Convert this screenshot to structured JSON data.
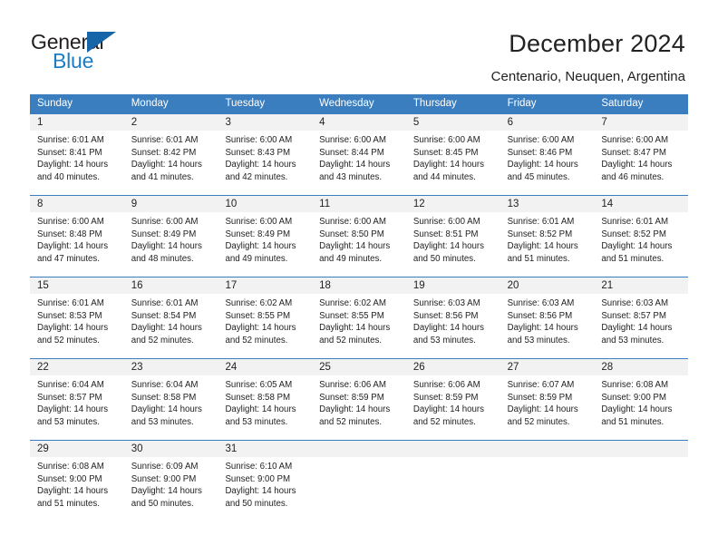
{
  "brand": {
    "name_part1": "General",
    "name_part2": "Blue",
    "triangle_icon": "triangle-icon",
    "accent_color": "#1d7dc4",
    "header_color": "#3a7ebf"
  },
  "header": {
    "title": "December 2024",
    "location": "Centenario, Neuquen, Argentina"
  },
  "calendar": {
    "weekdays": [
      "Sunday",
      "Monday",
      "Tuesday",
      "Wednesday",
      "Thursday",
      "Friday",
      "Saturday"
    ],
    "weeks": [
      [
        {
          "day": "1",
          "sunrise": "Sunrise: 6:01 AM",
          "sunset": "Sunset: 8:41 PM",
          "daylight_1": "Daylight: 14 hours",
          "daylight_2": "and 40 minutes."
        },
        {
          "day": "2",
          "sunrise": "Sunrise: 6:01 AM",
          "sunset": "Sunset: 8:42 PM",
          "daylight_1": "Daylight: 14 hours",
          "daylight_2": "and 41 minutes."
        },
        {
          "day": "3",
          "sunrise": "Sunrise: 6:00 AM",
          "sunset": "Sunset: 8:43 PM",
          "daylight_1": "Daylight: 14 hours",
          "daylight_2": "and 42 minutes."
        },
        {
          "day": "4",
          "sunrise": "Sunrise: 6:00 AM",
          "sunset": "Sunset: 8:44 PM",
          "daylight_1": "Daylight: 14 hours",
          "daylight_2": "and 43 minutes."
        },
        {
          "day": "5",
          "sunrise": "Sunrise: 6:00 AM",
          "sunset": "Sunset: 8:45 PM",
          "daylight_1": "Daylight: 14 hours",
          "daylight_2": "and 44 minutes."
        },
        {
          "day": "6",
          "sunrise": "Sunrise: 6:00 AM",
          "sunset": "Sunset: 8:46 PM",
          "daylight_1": "Daylight: 14 hours",
          "daylight_2": "and 45 minutes."
        },
        {
          "day": "7",
          "sunrise": "Sunrise: 6:00 AM",
          "sunset": "Sunset: 8:47 PM",
          "daylight_1": "Daylight: 14 hours",
          "daylight_2": "and 46 minutes."
        }
      ],
      [
        {
          "day": "8",
          "sunrise": "Sunrise: 6:00 AM",
          "sunset": "Sunset: 8:48 PM",
          "daylight_1": "Daylight: 14 hours",
          "daylight_2": "and 47 minutes."
        },
        {
          "day": "9",
          "sunrise": "Sunrise: 6:00 AM",
          "sunset": "Sunset: 8:49 PM",
          "daylight_1": "Daylight: 14 hours",
          "daylight_2": "and 48 minutes."
        },
        {
          "day": "10",
          "sunrise": "Sunrise: 6:00 AM",
          "sunset": "Sunset: 8:49 PM",
          "daylight_1": "Daylight: 14 hours",
          "daylight_2": "and 49 minutes."
        },
        {
          "day": "11",
          "sunrise": "Sunrise: 6:00 AM",
          "sunset": "Sunset: 8:50 PM",
          "daylight_1": "Daylight: 14 hours",
          "daylight_2": "and 49 minutes."
        },
        {
          "day": "12",
          "sunrise": "Sunrise: 6:00 AM",
          "sunset": "Sunset: 8:51 PM",
          "daylight_1": "Daylight: 14 hours",
          "daylight_2": "and 50 minutes."
        },
        {
          "day": "13",
          "sunrise": "Sunrise: 6:01 AM",
          "sunset": "Sunset: 8:52 PM",
          "daylight_1": "Daylight: 14 hours",
          "daylight_2": "and 51 minutes."
        },
        {
          "day": "14",
          "sunrise": "Sunrise: 6:01 AM",
          "sunset": "Sunset: 8:52 PM",
          "daylight_1": "Daylight: 14 hours",
          "daylight_2": "and 51 minutes."
        }
      ],
      [
        {
          "day": "15",
          "sunrise": "Sunrise: 6:01 AM",
          "sunset": "Sunset: 8:53 PM",
          "daylight_1": "Daylight: 14 hours",
          "daylight_2": "and 52 minutes."
        },
        {
          "day": "16",
          "sunrise": "Sunrise: 6:01 AM",
          "sunset": "Sunset: 8:54 PM",
          "daylight_1": "Daylight: 14 hours",
          "daylight_2": "and 52 minutes."
        },
        {
          "day": "17",
          "sunrise": "Sunrise: 6:02 AM",
          "sunset": "Sunset: 8:55 PM",
          "daylight_1": "Daylight: 14 hours",
          "daylight_2": "and 52 minutes."
        },
        {
          "day": "18",
          "sunrise": "Sunrise: 6:02 AM",
          "sunset": "Sunset: 8:55 PM",
          "daylight_1": "Daylight: 14 hours",
          "daylight_2": "and 52 minutes."
        },
        {
          "day": "19",
          "sunrise": "Sunrise: 6:03 AM",
          "sunset": "Sunset: 8:56 PM",
          "daylight_1": "Daylight: 14 hours",
          "daylight_2": "and 53 minutes."
        },
        {
          "day": "20",
          "sunrise": "Sunrise: 6:03 AM",
          "sunset": "Sunset: 8:56 PM",
          "daylight_1": "Daylight: 14 hours",
          "daylight_2": "and 53 minutes."
        },
        {
          "day": "21",
          "sunrise": "Sunrise: 6:03 AM",
          "sunset": "Sunset: 8:57 PM",
          "daylight_1": "Daylight: 14 hours",
          "daylight_2": "and 53 minutes."
        }
      ],
      [
        {
          "day": "22",
          "sunrise": "Sunrise: 6:04 AM",
          "sunset": "Sunset: 8:57 PM",
          "daylight_1": "Daylight: 14 hours",
          "daylight_2": "and 53 minutes."
        },
        {
          "day": "23",
          "sunrise": "Sunrise: 6:04 AM",
          "sunset": "Sunset: 8:58 PM",
          "daylight_1": "Daylight: 14 hours",
          "daylight_2": "and 53 minutes."
        },
        {
          "day": "24",
          "sunrise": "Sunrise: 6:05 AM",
          "sunset": "Sunset: 8:58 PM",
          "daylight_1": "Daylight: 14 hours",
          "daylight_2": "and 53 minutes."
        },
        {
          "day": "25",
          "sunrise": "Sunrise: 6:06 AM",
          "sunset": "Sunset: 8:59 PM",
          "daylight_1": "Daylight: 14 hours",
          "daylight_2": "and 52 minutes."
        },
        {
          "day": "26",
          "sunrise": "Sunrise: 6:06 AM",
          "sunset": "Sunset: 8:59 PM",
          "daylight_1": "Daylight: 14 hours",
          "daylight_2": "and 52 minutes."
        },
        {
          "day": "27",
          "sunrise": "Sunrise: 6:07 AM",
          "sunset": "Sunset: 8:59 PM",
          "daylight_1": "Daylight: 14 hours",
          "daylight_2": "and 52 minutes."
        },
        {
          "day": "28",
          "sunrise": "Sunrise: 6:08 AM",
          "sunset": "Sunset: 9:00 PM",
          "daylight_1": "Daylight: 14 hours",
          "daylight_2": "and 51 minutes."
        }
      ],
      [
        {
          "day": "29",
          "sunrise": "Sunrise: 6:08 AM",
          "sunset": "Sunset: 9:00 PM",
          "daylight_1": "Daylight: 14 hours",
          "daylight_2": "and 51 minutes."
        },
        {
          "day": "30",
          "sunrise": "Sunrise: 6:09 AM",
          "sunset": "Sunset: 9:00 PM",
          "daylight_1": "Daylight: 14 hours",
          "daylight_2": "and 50 minutes."
        },
        {
          "day": "31",
          "sunrise": "Sunrise: 6:10 AM",
          "sunset": "Sunset: 9:00 PM",
          "daylight_1": "Daylight: 14 hours",
          "daylight_2": "and 50 minutes."
        },
        {
          "day": "",
          "sunrise": "",
          "sunset": "",
          "daylight_1": "",
          "daylight_2": ""
        },
        {
          "day": "",
          "sunrise": "",
          "sunset": "",
          "daylight_1": "",
          "daylight_2": ""
        },
        {
          "day": "",
          "sunrise": "",
          "sunset": "",
          "daylight_1": "",
          "daylight_2": ""
        },
        {
          "day": "",
          "sunrise": "",
          "sunset": "",
          "daylight_1": "",
          "daylight_2": ""
        }
      ]
    ]
  }
}
